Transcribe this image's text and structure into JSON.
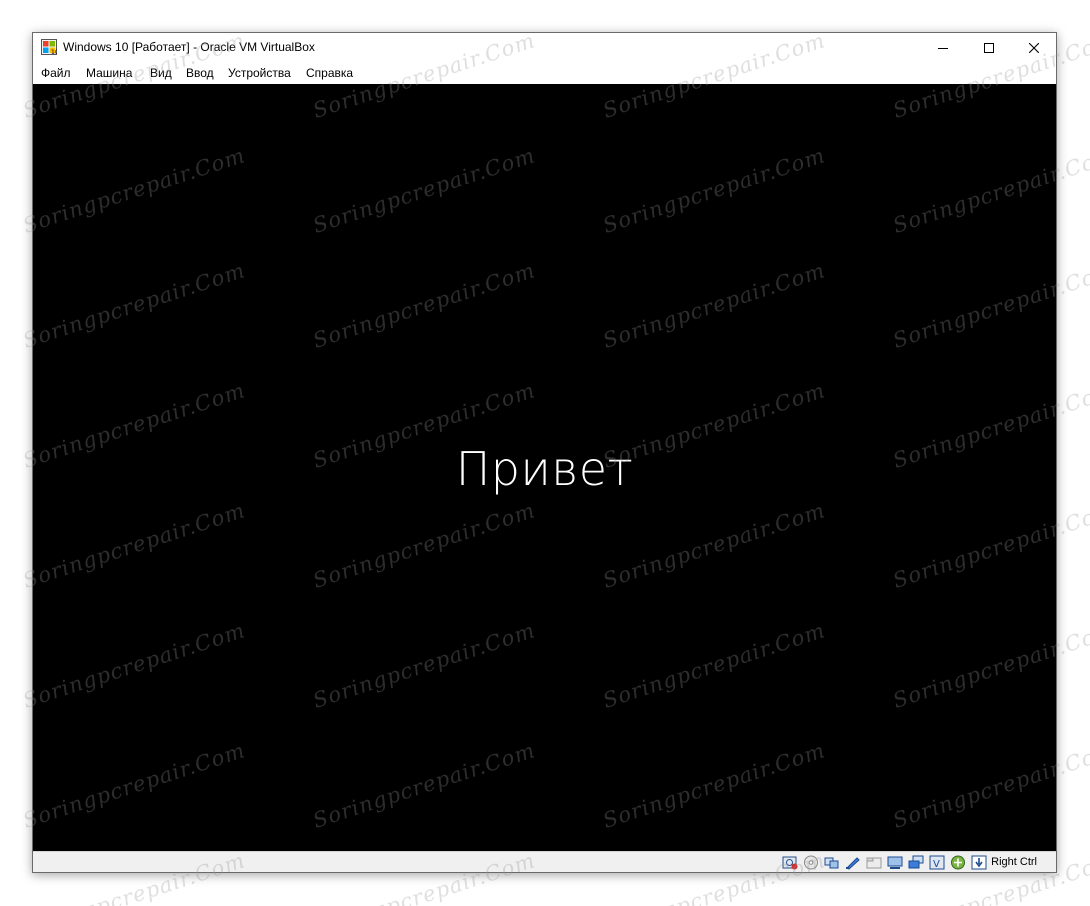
{
  "window": {
    "title": "Windows 10 [Работает] - Oracle VM VirtualBox",
    "app_icon": "windows-10-guest-icon",
    "controls": [
      "minimize-icon",
      "maximize-icon",
      "close-icon"
    ]
  },
  "menubar": {
    "items": [
      "Файл",
      "Машина",
      "Вид",
      "Ввод",
      "Устройства",
      "Справка"
    ]
  },
  "vm_screen": {
    "greeting": "Привет",
    "background_color": "#000000",
    "text_color": "#ffffff"
  },
  "statusbar": {
    "icons": [
      "hard-disk-icon",
      "optical-drive-icon",
      "audio-icon",
      "network-icon",
      "usb-icon",
      "shared-folders-icon",
      "display-icon",
      "video-capture-icon",
      "cpu-vtx-icon",
      "mouse-integration-icon",
      "keyboard-capture-icon"
    ],
    "host_key": "Right Ctrl"
  },
  "watermark": "Soringpcrepair.Com"
}
